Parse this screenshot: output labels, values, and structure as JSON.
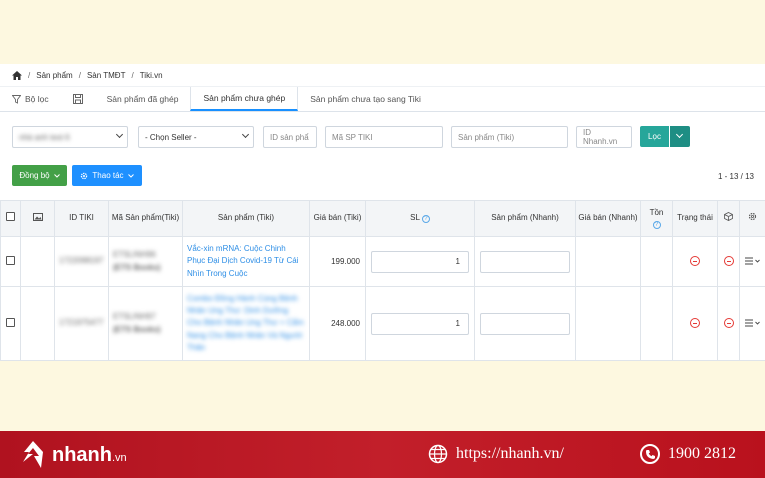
{
  "breadcrumb": [
    "Sản phẩm",
    "Sàn TMĐT",
    "Tiki.vn"
  ],
  "tabs": [
    {
      "label": "Bộ lọc"
    },
    {
      "label": ""
    },
    {
      "label": "Sản phẩm đã ghép"
    },
    {
      "label": "Sản phẩm chưa ghép"
    },
    {
      "label": "Sản phẩm chưa tạo sang Tiki"
    }
  ],
  "filters": {
    "shop_value": "nhà anh test 6",
    "seller_value": "- Chọn Seller -",
    "id_product_placeholder": "ID sản phẩ",
    "sku_tiki_placeholder": "Mã SP TIKI",
    "product_tiki_placeholder": "Sản phẩm (Tiki)",
    "id_nhanh_placeholder": "ID Nhanh.vn",
    "filter_button": "Lọc"
  },
  "actions": {
    "sync_label": "Đồng bộ",
    "operations_label": "Thao tác",
    "pagination": "1 - 13 / 13"
  },
  "table": {
    "headers": {
      "id_tiki": "ID TIKI",
      "sku": "Mã Sản phẩm(Tiki)",
      "product_tiki": "Sản phẩm (Tiki)",
      "price": "Giá bán (Tiki)",
      "qty": "SL",
      "product_nhanh": "Sản phẩm (Nhanh)",
      "price_nhanh": "Giá bán (Nhanh)",
      "stock": "Tồn",
      "status": "Trạng thái"
    },
    "rows": [
      {
        "id": "1722098197",
        "sku": "ETSLINH96",
        "seller": "(ETS Books)",
        "name": "Vắc-xin mRNA: Cuộc Chinh Phục Đại Dịch Covid-19 Từ Cái Nhìn Trong Cuộc",
        "price": "199.000",
        "qty": "1"
      },
      {
        "id": "1721975477",
        "sku": "ETSLINH97",
        "seller": "(ETS Books)",
        "name": "Combo Đồng Hành Cùng Bệnh Nhân Ung Thư: Dinh Dưỡng Cho Bệnh Nhân Ung Thư + Cẩm Nang Cho Bệnh Nhân Và Người Thân",
        "price": "248.000",
        "qty": "1"
      }
    ]
  },
  "footer": {
    "logo": "nhanh",
    "logo_suffix": ".vn",
    "url": "https://nhanh.vn/",
    "phone": "1900 2812"
  },
  "colors": {
    "accent": "#1890ff",
    "green": "#43a047",
    "teal": "#26a69a",
    "footer_red": "#c21f2a"
  }
}
